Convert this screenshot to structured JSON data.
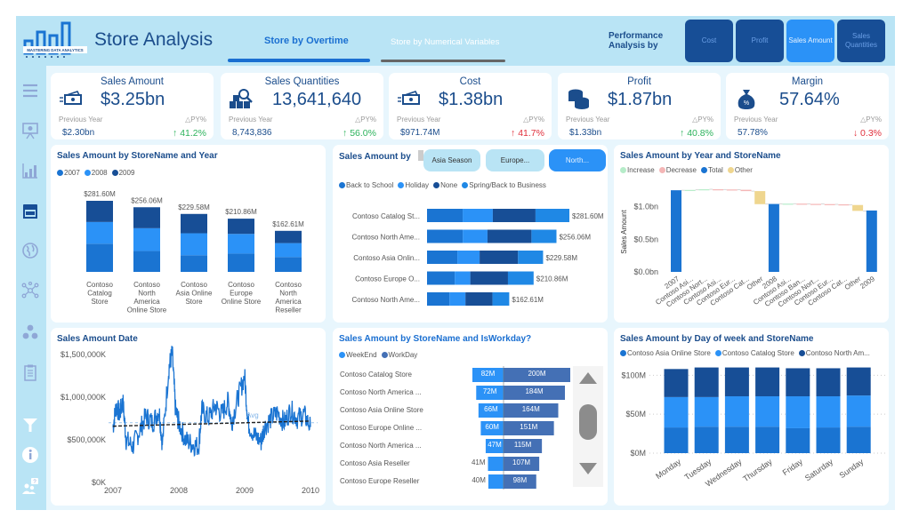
{
  "app": {
    "title": "Store Analysis",
    "logo_text": "MASTERING DATA ANALYTICS",
    "tabs": [
      {
        "label": "Store by Overtime",
        "active": true
      },
      {
        "label": "Store by Numerical Variables",
        "active": false
      }
    ],
    "performance_label": "Performance Analysis by",
    "performance_buttons": [
      {
        "label": "Cost",
        "active": false
      },
      {
        "label": "Profit",
        "active": false
      },
      {
        "label": "Sales Amount",
        "active": true
      },
      {
        "label": "Sales Quantities",
        "active": false
      }
    ]
  },
  "sidebar": {
    "items": [
      {
        "icon": "menu-icon"
      },
      {
        "icon": "presentation-icon"
      },
      {
        "icon": "bar-chart-icon"
      },
      {
        "icon": "store-icon",
        "active": true
      },
      {
        "icon": "globe-icon"
      },
      {
        "icon": "network-icon"
      },
      {
        "icon": "hierarchy-icon"
      },
      {
        "icon": "clipboard-icon"
      },
      {
        "icon": "filter-icon"
      },
      {
        "icon": "info-icon"
      },
      {
        "icon": "help-people-icon"
      }
    ]
  },
  "kpis": [
    {
      "title": "Sales Amount",
      "icon": "money-icon",
      "value": "$3.25bn",
      "prev_label": "Previous Year",
      "prev_value": "$2.30bn",
      "py_label": "△PY%",
      "py_value": "↑ 41.2%",
      "trend": "up"
    },
    {
      "title": "Sales Quantities",
      "icon": "boxes-search-icon",
      "value": "13,641,640",
      "prev_label": "Previous Year",
      "prev_value": "8,743,836",
      "py_label": "△PY%",
      "py_value": "↑ 56.0%",
      "trend": "up"
    },
    {
      "title": "Cost",
      "icon": "money-icon",
      "value": "$1.38bn",
      "prev_label": "Previous Year",
      "prev_value": "$971.74M",
      "py_label": "△PY%",
      "py_value": "↑ 41.7%",
      "trend": "down"
    },
    {
      "title": "Profit",
      "icon": "coins-icon",
      "value": "$1.87bn",
      "prev_label": "Previous Year",
      "prev_value": "$1.33bn",
      "py_label": "△PY%",
      "py_value": "↑ 40.8%",
      "trend": "up"
    },
    {
      "title": "Margin",
      "icon": "money-bag-percent-icon",
      "value": "57.64%",
      "prev_label": "Previous Year",
      "prev_value": "57.78%",
      "py_label": "△PY%",
      "py_value": "↓ 0.3%",
      "trend": "down"
    }
  ],
  "colors": {
    "c2007": "#1a74d2",
    "c2008": "#2b92f7",
    "c2009": "#174e96",
    "increase": "#b6ecc9",
    "decrease": "#f4b6b6",
    "total": "#1a74d2",
    "other": "#efd68f",
    "weekend": "#2b92f7",
    "workday": "#4470b5"
  },
  "slicer": {
    "label": "Sales Amount  by",
    "buttons": [
      {
        "label": "Asia Season",
        "active": false
      },
      {
        "label": "Europe...",
        "active": false
      },
      {
        "label": "North...",
        "active": true
      }
    ]
  },
  "chart_data": [
    {
      "id": "store_year",
      "type": "bar",
      "title": "Sales Amount by StoreName and Year",
      "stacked": true,
      "categories": [
        "Contoso Catalog Store",
        "Contoso North America Online Store",
        "Contoso Asia Online Store",
        "Contoso Europe Online Store",
        "Contoso North America Reseller"
      ],
      "category_lines": [
        [
          "Contoso",
          "Catalog",
          "Store"
        ],
        [
          "Contoso",
          "North",
          "America",
          "Online Store"
        ],
        [
          "Contoso",
          "Asia Online",
          "Store"
        ],
        [
          "Contoso",
          "Europe",
          "Online Store"
        ],
        [
          "Contoso",
          "North",
          "America",
          "Reseller"
        ]
      ],
      "series": [
        {
          "name": "2007",
          "values": [
            111.6,
            83.0,
            66.0,
            72.5,
            59.0
          ]
        },
        {
          "name": "2008",
          "values": [
            86.0,
            90.0,
            87.0,
            78.0,
            55.0
          ]
        },
        {
          "name": "2009",
          "values": [
            84.0,
            83.06,
            76.58,
            60.36,
            48.61
          ]
        }
      ],
      "totals": [
        281.6,
        256.06,
        229.58,
        210.86,
        162.61
      ],
      "total_labels": [
        "$281.60M",
        "$256.06M",
        "$229.58M",
        "$210.86M",
        "$162.61M"
      ]
    },
    {
      "id": "store_season",
      "type": "bar",
      "orientation": "horizontal",
      "stacked": true,
      "categories": [
        "Contoso Catalog St...",
        "Contoso North Ame...",
        "Contoso Asia Onlin...",
        "Contoso Europe O...",
        "Contoso North Ame..."
      ],
      "series": [
        {
          "name": "Back to School",
          "values": [
            70.5,
            70.6,
            60.0,
            54.8,
            44.5
          ]
        },
        {
          "name": "Holiday",
          "values": [
            59.6,
            49.0,
            44.0,
            30.8,
            31.5
          ]
        },
        {
          "name": "None",
          "values": [
            84.5,
            87.0,
            76.0,
            74.5,
            53.5
          ]
        },
        {
          "name": "Spring/Back to Business",
          "values": [
            67.0,
            49.46,
            49.58,
            50.76,
            33.11
          ]
        }
      ],
      "total_labels": [
        "$281.60M",
        "$256.06M",
        "$229.58M",
        "$210.86M",
        "$162.61M"
      ],
      "totals": [
        281.6,
        256.06,
        229.58,
        210.86,
        162.61
      ]
    },
    {
      "id": "waterfall",
      "type": "bar",
      "subtype": "waterfall",
      "title": "Sales Amount by Year and StoreName",
      "ylabel": "Sales Amount",
      "ylim": [
        0,
        1.3
      ],
      "y_ticks": [
        "$0.0bn",
        "$0.5bn",
        "$1.0bn"
      ],
      "y_tick_values": [
        0,
        0.5,
        1.0
      ],
      "legend": [
        "Increase",
        "Decrease",
        "Total",
        "Other"
      ],
      "categories": [
        "2007",
        "Contoso Asi...",
        "Contoso Nort...",
        "Contoso Asi...",
        "Contoso Eur...",
        "Contoso Cat...",
        "Other",
        "2008",
        "Contoso Asi...",
        "Contoso Ban...",
        "Contoso Nort...",
        "Contoso Eur...",
        "Contoso Cat...",
        "Other",
        "2009"
      ],
      "kinds": [
        "total",
        "increase",
        "increase",
        "decrease",
        "decrease",
        "decrease",
        "other",
        "total",
        "increase",
        "decrease",
        "decrease",
        "decrease",
        "decrease",
        "other",
        "total"
      ],
      "values": [
        1.25,
        0.005,
        0.01,
        -0.003,
        -0.005,
        -0.02,
        -0.2,
        1.04,
        0.005,
        -0.004,
        -0.003,
        -0.004,
        -0.01,
        -0.09,
        0.94
      ]
    },
    {
      "id": "sales_date",
      "type": "line",
      "title": "Sales Amount Date",
      "x_ticks": [
        "2007",
        "2008",
        "2009",
        "2010"
      ],
      "y_ticks": [
        "$0K",
        "$500,000K",
        "$1,000,000K",
        "$1,500,000K"
      ],
      "y_tick_values": [
        0,
        500000,
        1000000,
        1500000
      ],
      "ylim": [
        0,
        1500000
      ],
      "xlim": [
        2007,
        2010
      ],
      "average_label": "Avg",
      "average_value": 700000,
      "trend_start": 660000,
      "trend_end": 720000,
      "key_points": [
        [
          2007.0,
          650000
        ],
        [
          2007.05,
          900000
        ],
        [
          2007.1,
          800000
        ],
        [
          2007.15,
          950000
        ],
        [
          2007.2,
          500000
        ],
        [
          2007.3,
          420000
        ],
        [
          2007.4,
          600000
        ],
        [
          2007.5,
          780000
        ],
        [
          2007.6,
          700000
        ],
        [
          2007.7,
          850000
        ],
        [
          2007.75,
          450000
        ],
        [
          2007.85,
          1350000
        ],
        [
          2007.9,
          1520000
        ],
        [
          2007.95,
          850000
        ],
        [
          2008.0,
          700000
        ],
        [
          2008.1,
          500000
        ],
        [
          2008.2,
          450000
        ],
        [
          2008.3,
          420000
        ],
        [
          2008.35,
          850000
        ],
        [
          2008.45,
          750000
        ],
        [
          2008.55,
          900000
        ],
        [
          2008.65,
          800000
        ],
        [
          2008.75,
          950000
        ],
        [
          2008.8,
          700000
        ],
        [
          2008.9,
          1000000
        ],
        [
          2009.0,
          1250000
        ],
        [
          2009.05,
          700000
        ],
        [
          2009.15,
          550000
        ],
        [
          2009.25,
          480000
        ],
        [
          2009.3,
          650000
        ],
        [
          2009.4,
          750000
        ],
        [
          2009.5,
          820000
        ],
        [
          2009.6,
          700000
        ],
        [
          2009.7,
          850000
        ],
        [
          2009.8,
          750000
        ],
        [
          2009.9,
          800000
        ],
        [
          2010.0,
          650000
        ]
      ]
    },
    {
      "id": "store_workday",
      "type": "bar",
      "orientation": "horizontal",
      "subtype": "diverging",
      "title": "Sales Amount by StoreName and IsWorkday?",
      "categories": [
        "Contoso Catalog Store",
        "Contoso North America ...",
        "Contoso Asia Online Store",
        "Contoso Europe Online ...",
        "Contoso North America ...",
        "Contoso Asia Reseller",
        "Contoso Europe Reseller"
      ],
      "series": [
        {
          "name": "WeekEnd",
          "values": [
            82,
            72,
            66,
            60,
            47,
            41,
            40
          ]
        },
        {
          "name": "WorkDay",
          "values": [
            200,
            184,
            164,
            151,
            115,
            107,
            98
          ]
        }
      ],
      "weekend_labels": [
        "82M",
        "72M",
        "66M",
        "60M",
        "47M",
        "41M",
        "40M"
      ],
      "workday_labels": [
        "200M",
        "184M",
        "164M",
        "151M",
        "115M",
        "107M",
        "98M"
      ]
    },
    {
      "id": "day_of_week",
      "type": "bar",
      "stacked": true,
      "title": "Sales Amount by Day of week and StoreName",
      "categories": [
        "Monday",
        "Tuesday",
        "Wednesday",
        "Thursday",
        "Friday",
        "Saturday",
        "Sunday"
      ],
      "y_ticks": [
        "$0M",
        "$50M",
        "$100M"
      ],
      "y_tick_values": [
        0,
        50,
        100
      ],
      "ylim": [
        0,
        115
      ],
      "series": [
        {
          "name": "Contoso Asia Online Store",
          "values": [
            33,
            34,
            34,
            34,
            32,
            33,
            34
          ]
        },
        {
          "name": "Contoso Catalog Store",
          "values": [
            39,
            38,
            39,
            39,
            41,
            40,
            40
          ]
        },
        {
          "name": "Contoso North Am...",
          "values": [
            36,
            38,
            37,
            37,
            36,
            36,
            36
          ]
        }
      ]
    }
  ]
}
